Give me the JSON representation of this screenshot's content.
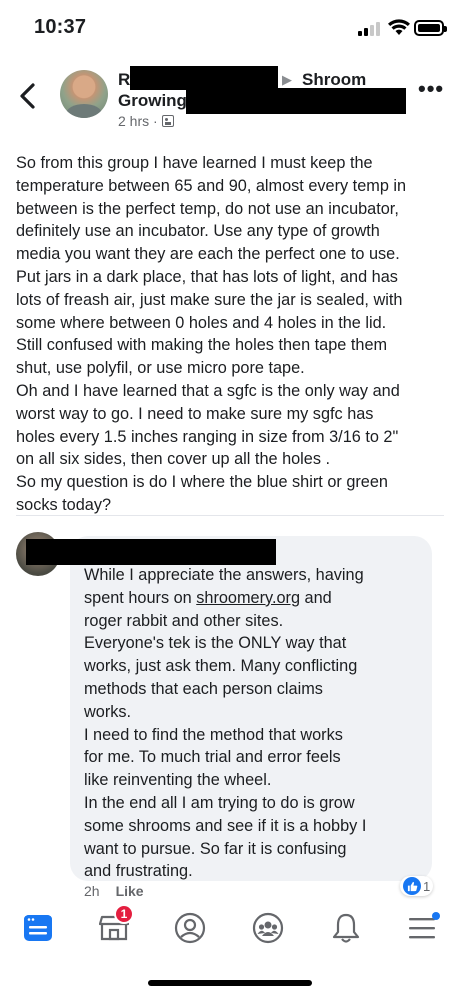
{
  "status_bar": {
    "time": "10:37"
  },
  "post": {
    "author_initial": "R",
    "group_name": "Shroom",
    "group_name_line2": "Growing",
    "timestamp": "2 hrs ·",
    "body_lines": [
      "So from this group I have learned I must keep the",
      "temperature between 65 and 90, almost every temp in",
      "between is the perfect temp, do not use an incubator,",
      "definitely use an incubator. Use any type of growth",
      "media you want they are each the perfect one to use.",
      "Put jars in a dark place, that has lots of light, and has",
      "lots of freash air, just make sure the jar is sealed, with",
      "some where between 0 holes and 4 holes in the lid.",
      "Still confused with making the holes then tape them",
      "shut, use polyfil, or use micro pore tape.",
      "Oh and I have learned that a sgfc is the only way and",
      "worst way to go. I need to make sure my sgfc has",
      "holes every 1.5 inches ranging in size from 3/16 to 2\"",
      "on all six sides, then cover up all the holes .",
      "So my question is do I where the blue shirt or green",
      "socks today?"
    ]
  },
  "comment": {
    "lines": [
      "While I appreciate the answers, having",
      "spent hours on",
      "shroomery.org",
      " and",
      "roger rabbit and other sites.",
      "Everyone's tek is the ONLY way that",
      "works, just ask them. Many conflicting",
      "methods that each person claims",
      "works.",
      "I need to find the method that works",
      "for me. To much trial and error feels",
      "like reinventing the wheel.",
      "In the end all I am trying to do is grow",
      "some shrooms and see if it is a hobby I",
      "want to pursue. So far it is confusing",
      "and frustrating."
    ],
    "time": "2h",
    "like_label": "Like",
    "reaction_count": "1"
  },
  "tab_bar": {
    "marketplace_badge": "1"
  },
  "icons": {
    "back": "chevron-left-icon",
    "more": "more-dots-icon",
    "privacy": "group-privacy-icon",
    "reaction": "thumbs-up-icon",
    "tabs": [
      "news-feed-icon",
      "marketplace-icon",
      "profile-icon",
      "groups-icon",
      "notifications-icon",
      "menu-icon"
    ]
  },
  "colors": {
    "accent": "#1877f2",
    "badge": "#e41e3f",
    "bubble": "#f0f2f5",
    "muted": "#65676b"
  }
}
